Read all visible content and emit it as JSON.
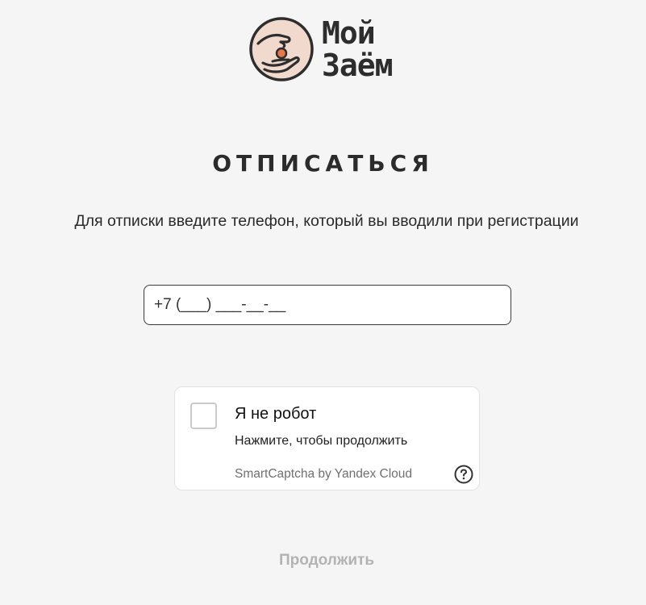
{
  "logo": {
    "line1": "Мой",
    "line2": "Заём",
    "icon": "hand-with-coin-icon"
  },
  "page": {
    "title": "ОТПИСАТЬСЯ",
    "instruction": "Для отписки введите телефон, который вы вводили при регистрации"
  },
  "phone": {
    "value": "+7 (___) ___-__-__"
  },
  "captcha": {
    "title": "Я не робот",
    "subtitle": "Нажмите, чтобы продолжить",
    "brand": "SmartCaptcha by Yandex Cloud",
    "help_icon": "question-circle-icon"
  },
  "actions": {
    "continue_label": "Продолжить"
  },
  "colors": {
    "background": "#f5f5f5",
    "logo_accent": "#f2d9cd",
    "coin": "#e8764e",
    "disabled_text": "#b3b3b3"
  }
}
